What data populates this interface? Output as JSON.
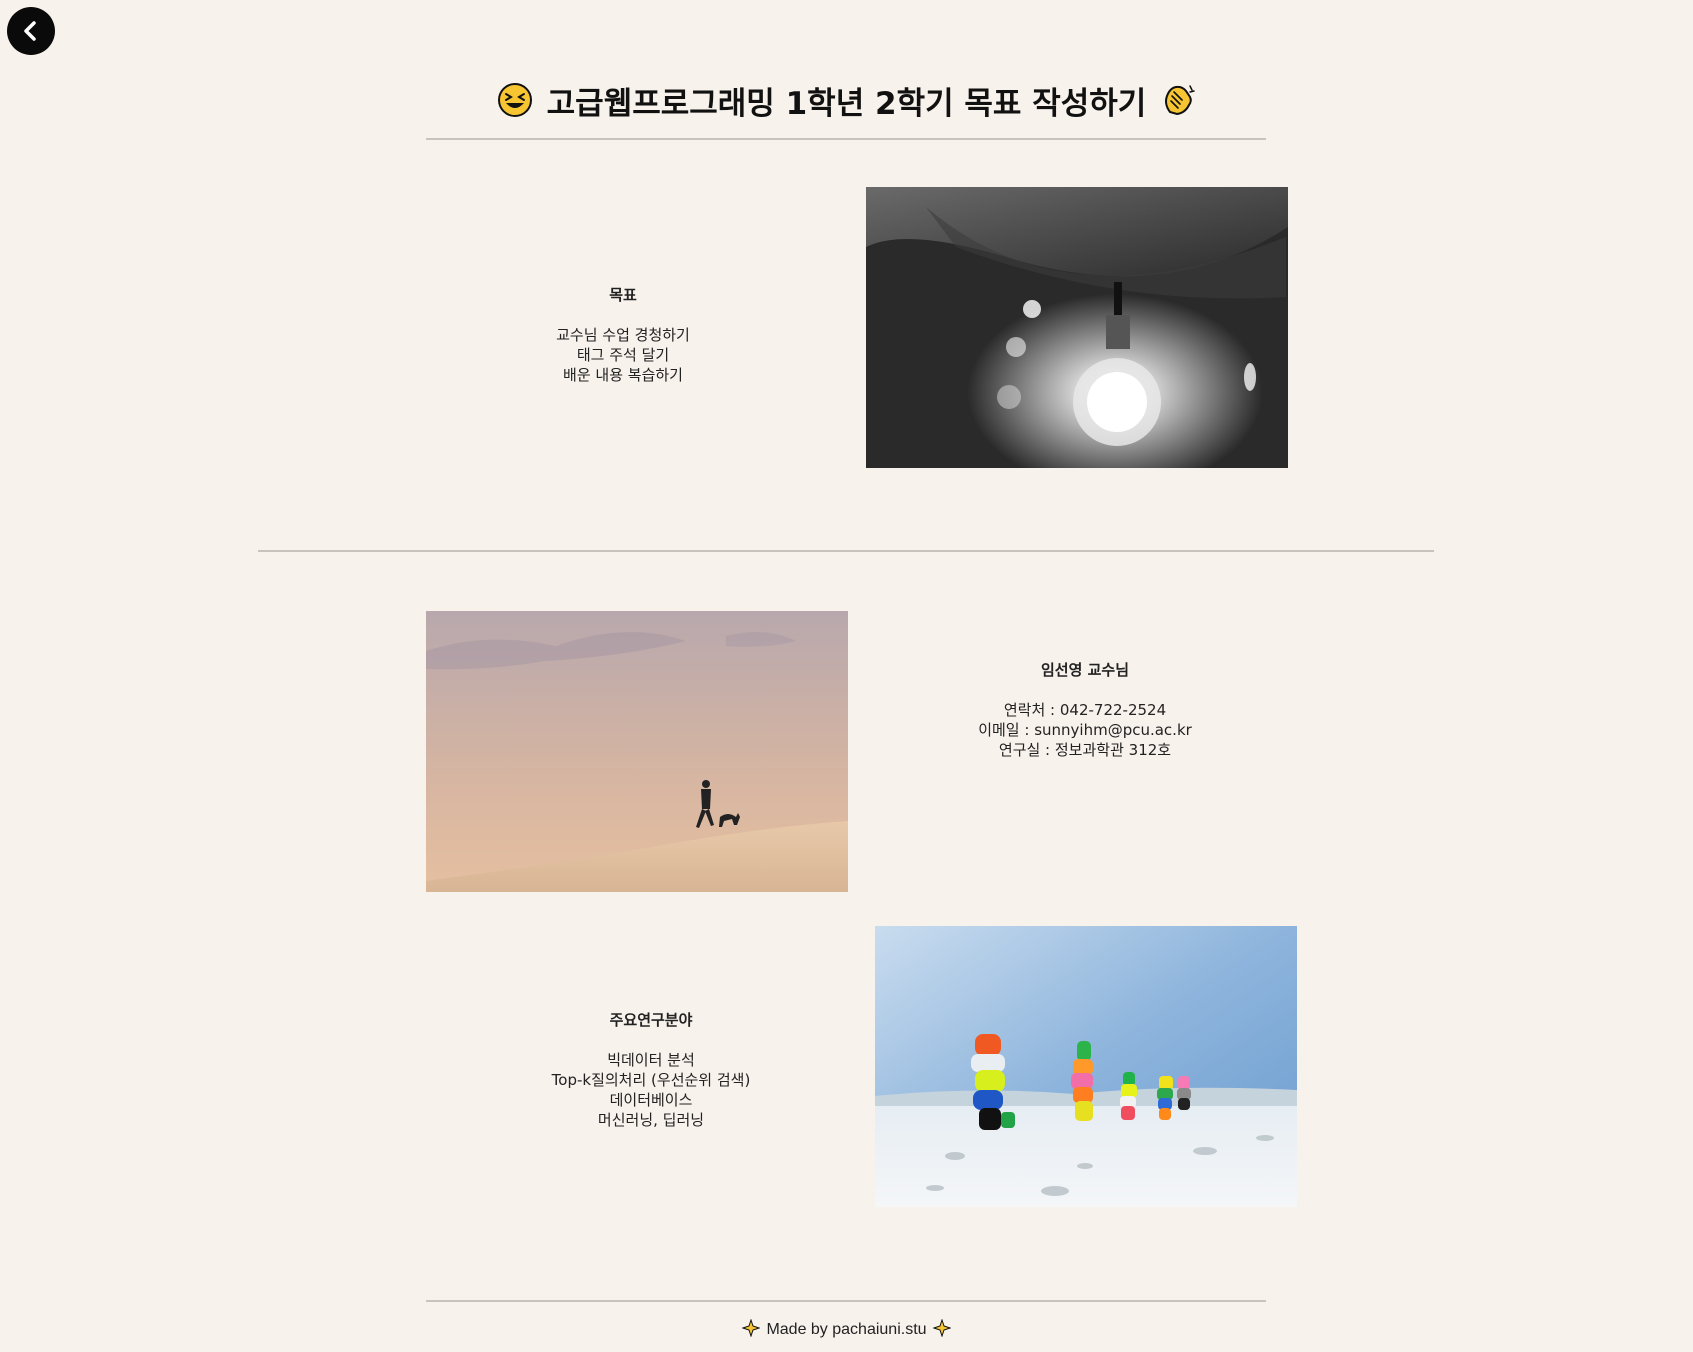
{
  "nav": {
    "back_icon": "chevron-left-icon"
  },
  "header": {
    "title": "고급웹프로그래밍 1학년 2학기 목표 작성하기",
    "left_emoji": "laughing-face-icon",
    "right_emoji": "clapping-hands-icon"
  },
  "goals": {
    "heading": "목표",
    "items": [
      "교수님 수업 경청하기",
      "태그 주석 달기",
      "배운 내용 복습하기"
    ],
    "image": "lightbulb-photo"
  },
  "professor": {
    "heading": "임선영 교수님",
    "items": [
      "연락처 : 042-722-2524",
      "이메일 : sunnyihm@pcu.ac.kr",
      "연구실 : 정보과학관 312호"
    ],
    "image": "desert-walk-photo"
  },
  "research": {
    "heading": "주요연구분야",
    "items": [
      "빅데이터 분석",
      "Top-k질의처리 (우선순위 검색)",
      "데이터베이스",
      "머신러닝, 딥러닝"
    ],
    "image": "colorful-rocks-photo"
  },
  "footer": {
    "text": "Made by pachaiuni.stu",
    "icon": "sparkles-icon"
  }
}
